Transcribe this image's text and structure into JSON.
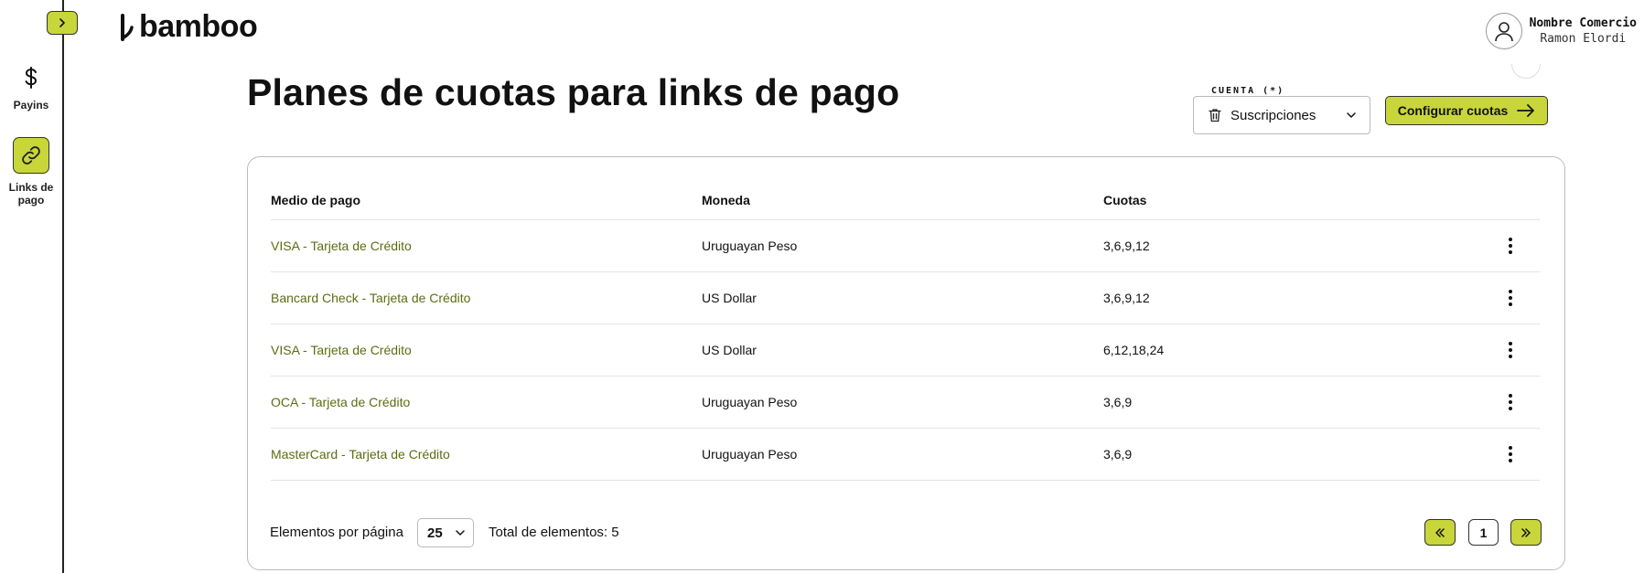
{
  "sidebar": {
    "items": [
      {
        "label": "Payins",
        "icon": "dollar-icon"
      },
      {
        "label": "Links de pago",
        "icon": "link-icon",
        "active": true
      }
    ]
  },
  "header": {
    "logo_text": "bamboo",
    "user": {
      "company": "Nombre Comercio",
      "name": "Ramon Elordi"
    }
  },
  "main": {
    "title": "Planes de cuotas para links de pago",
    "account": {
      "legend": "CUENTA (*)",
      "value": "Suscripciones"
    },
    "configure_label": "Configurar cuotas",
    "table": {
      "headers": [
        "Medio de pago",
        "Moneda",
        "Cuotas"
      ],
      "rows": [
        {
          "method": "VISA - Tarjeta de Crédito",
          "currency": "Uruguayan Peso",
          "quotas": "3,6,9,12"
        },
        {
          "method": "Bancard Check - Tarjeta de Crédito",
          "currency": "US Dollar",
          "quotas": "3,6,9,12"
        },
        {
          "method": "VISA - Tarjeta de Crédito",
          "currency": "US Dollar",
          "quotas": "6,12,18,24"
        },
        {
          "method": "OCA - Tarjeta de Crédito",
          "currency": "Uruguayan Peso",
          "quotas": "3,6,9"
        },
        {
          "method": "MasterCard - Tarjeta de Crédito",
          "currency": "Uruguayan Peso",
          "quotas": "3,6,9"
        }
      ]
    },
    "footer": {
      "per_page_label": "Elementos por página",
      "per_page_value": "25",
      "total_label": "Total de elementos: 5",
      "current_page": "1"
    }
  },
  "colors": {
    "accent": "#c8d63a",
    "link": "#5a6e12",
    "border": "#bbbbbb"
  }
}
